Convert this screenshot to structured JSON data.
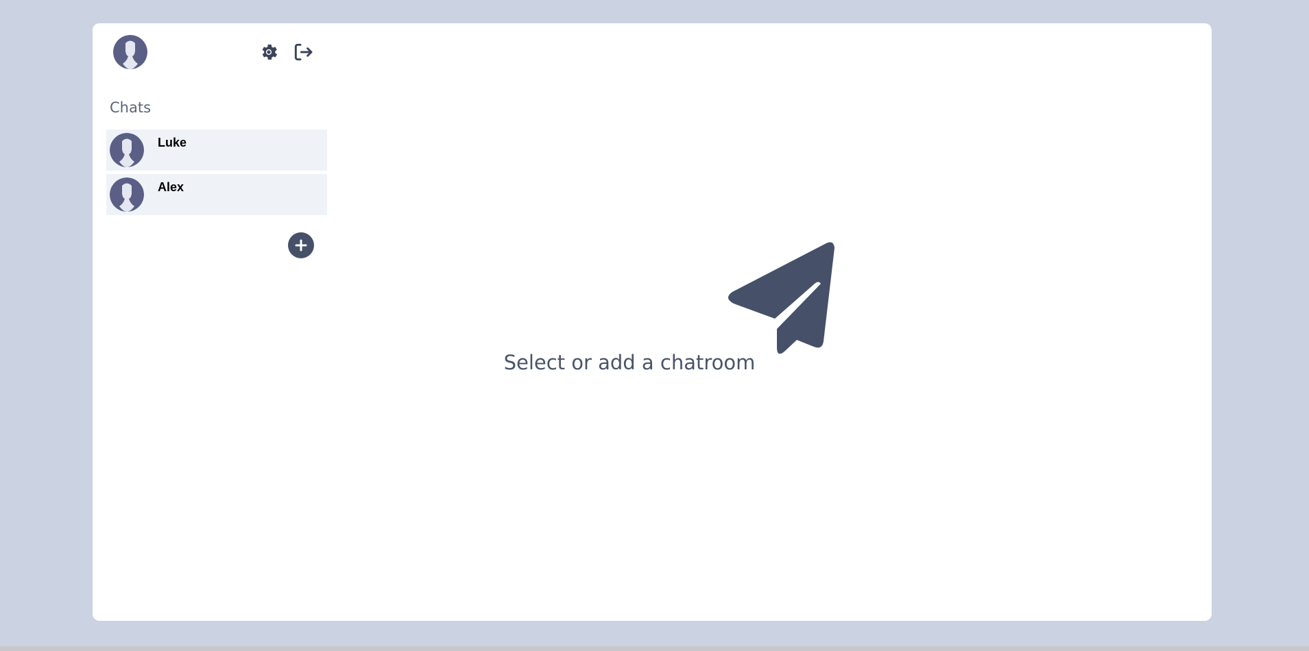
{
  "sidebar": {
    "chats_heading": "Chats",
    "icons": {
      "profile": "user-avatar-icon",
      "settings": "gear-icon",
      "logout": "logout-icon",
      "add": "plus-icon"
    },
    "chats": [
      {
        "name": "Luke"
      },
      {
        "name": "Alex"
      }
    ]
  },
  "main": {
    "empty_icon": "paper-plane-icon",
    "empty_message": "Select or add a chatroom"
  },
  "colors": {
    "background": "#cbd2e1",
    "card": "#ffffff",
    "accent": "#465068",
    "chat_item_bg": "#eff2f7"
  }
}
